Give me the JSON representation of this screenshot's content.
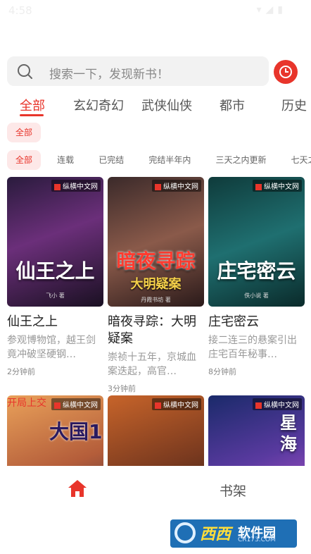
{
  "status": {
    "time": "4:58",
    "icons": "▾◢▮"
  },
  "search": {
    "placeholder": "搜索一下，发现新书！"
  },
  "tabs": [
    "全部",
    "玄幻奇幻",
    "武侠仙侠",
    "都市",
    "历史"
  ],
  "filter1": {
    "label": "全部"
  },
  "filter2": [
    "全部",
    "连载",
    "已完结",
    "完结半年内",
    "三天之内更新",
    "七天之内更新"
  ],
  "publisher": "纵横中文网",
  "books": [
    {
      "cover_title": "仙王之上",
      "cover_author": "飞小 著",
      "title": "仙王之上",
      "desc": "参观博物馆，越王剑竟冲破坚硬钢…",
      "time": "2分钟前"
    },
    {
      "cover_title": "暗夜寻踪",
      "cover_sub": "大明疑案",
      "cover_author": "丹霞书坊 著",
      "title": "暗夜寻踪：大明疑案",
      "desc": "崇祯十五年，京城血案迭起，高官…",
      "time": "3分钟前"
    },
    {
      "cover_title": "庄宅密云",
      "cover_author": "佚小说 著",
      "title": "庄宅密云",
      "desc": "接二连三的悬案引出庄宅百年秘事…",
      "time": "8分钟前"
    },
    {
      "cover_title": "大国1",
      "cover_sub": "开局上交",
      "title": "",
      "desc": "",
      "time": ""
    },
    {
      "cover_title": "",
      "title": "",
      "desc": "",
      "time": ""
    },
    {
      "cover_title": "星海",
      "title": "",
      "desc": "",
      "time": ""
    }
  ],
  "bottom_nav": {
    "shelf_label": "书架"
  },
  "watermark": {
    "brand": "西西",
    "name": "软件园",
    "url": "CR173.COM"
  },
  "colors": {
    "accent": "#e8352b"
  }
}
